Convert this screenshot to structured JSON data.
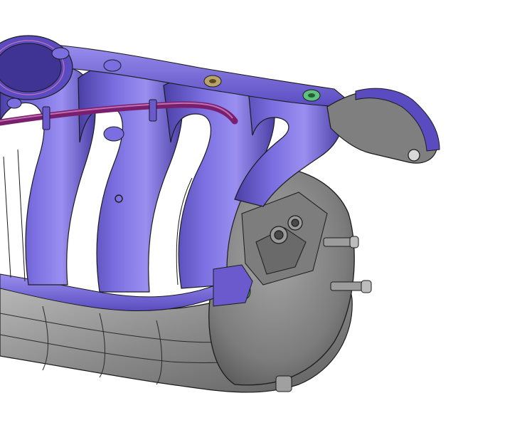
{
  "scene": {
    "subject": "",
    "colors": {
      "background": "#ffffff",
      "plenum_gray": "#8a8a8a",
      "plenum_gray_dark": "#5f5f5f",
      "plenum_gray_light": "#b9b9b9",
      "runner_purple": "#6a5acd",
      "runner_purple_dark": "#4b3fa6",
      "runner_purple_light": "#9a8ff0",
      "tube_magenta": "#7a1f6e",
      "fitting_gold": "#b8a46a",
      "fitting_green": "#5fbf7f",
      "edge_lines": "#1b1b1b"
    }
  }
}
